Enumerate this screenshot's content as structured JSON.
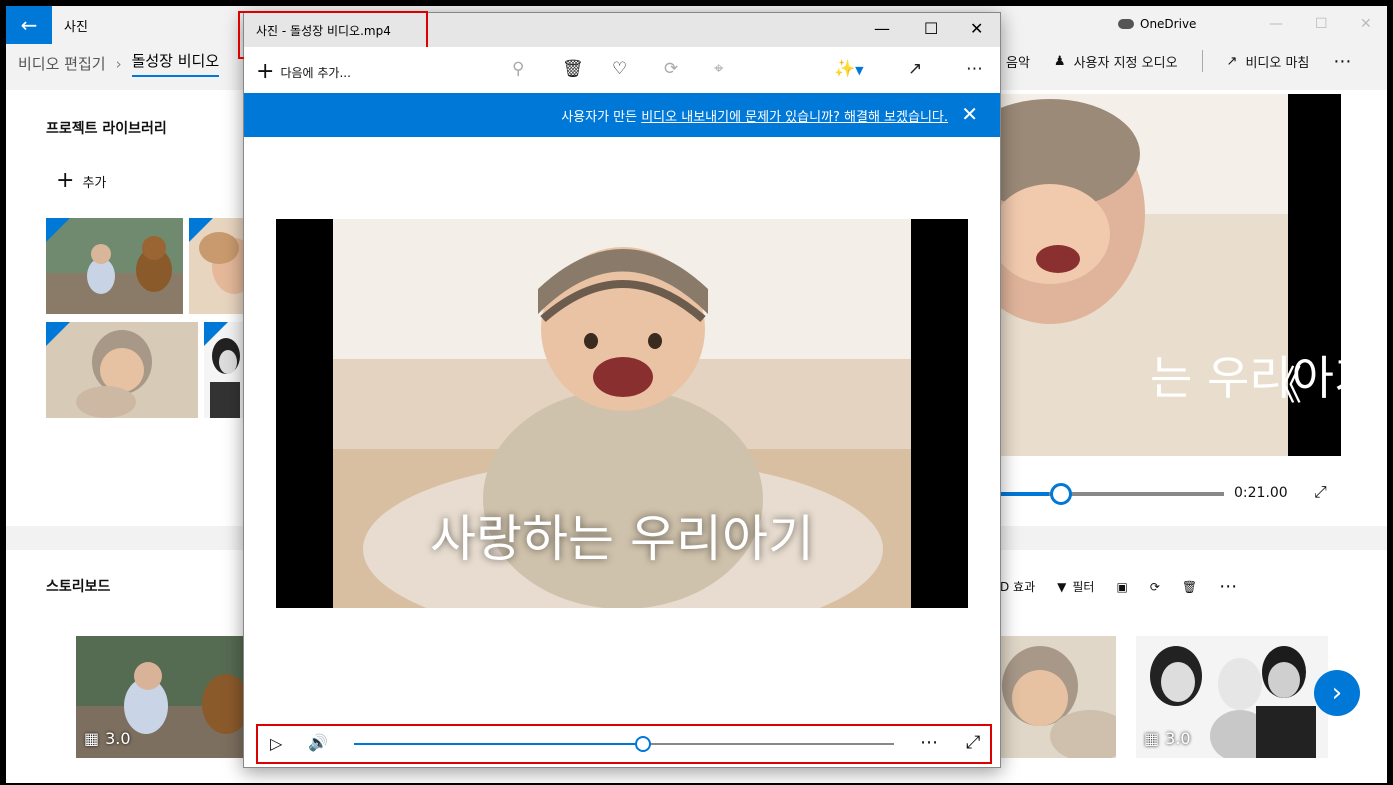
{
  "app": {
    "title": "사진",
    "onedrive": "OneDrive",
    "back_icon": "arrow-left-icon"
  },
  "breadcrumb": {
    "parent": "비디오 편집기",
    "current": "돌성장 비디오"
  },
  "right_toolbar": {
    "music": "음악",
    "custom_audio": "사용자 지정 오디오",
    "finish_video": "비디오 마침"
  },
  "library": {
    "title": "프로젝트 라이브러리",
    "add_label": "추가"
  },
  "preview": {
    "time": "0:21.00",
    "progress": 0.22
  },
  "storyboard": {
    "title": "스토리보드",
    "toolbar": {
      "effects_3d": "D 효과",
      "filter": "필터"
    },
    "cards": [
      {
        "duration": "3.0"
      },
      {
        "duration": "3.0"
      }
    ]
  },
  "popup": {
    "title": "사진 - 돌성장 비디오.mp4",
    "add_to": "다음에 추가...",
    "banner_prefix": "사용자가 만든 ",
    "banner_link": "비디오 내보내기에 문제가 있습니까? 해결해 보겠습니다.",
    "caption": "사랑하는 우리아기",
    "playback_progress": 0.53
  },
  "colors": {
    "accent": "#0078d7",
    "highlight": "#dd0000"
  }
}
